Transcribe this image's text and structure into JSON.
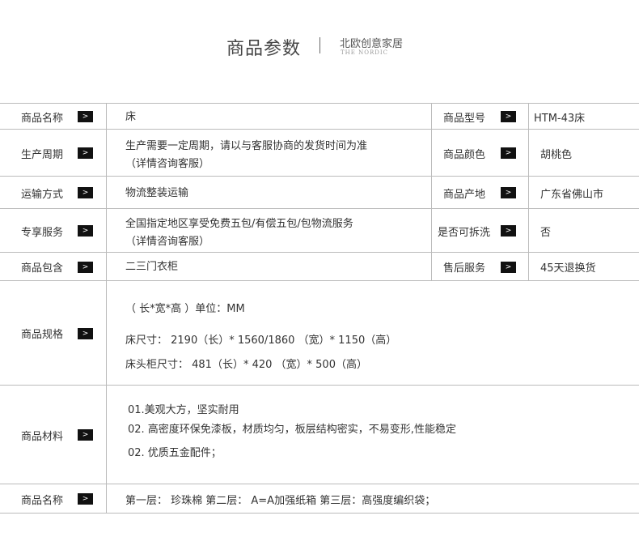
{
  "header": {
    "title": "商品参数",
    "subtitle": "北欧创意家居",
    "subtitle_en": "THE NORDIC"
  },
  "arrow_glyph": ">",
  "rows": [
    {
      "label": "商品名称",
      "value": "床",
      "label2": "商品型号",
      "value2": "HTM-43床"
    },
    {
      "label": "生产周期",
      "value_lines": [
        "生产需要一定周期，请以与客服协商的发货时间为准",
        "（详情咨询客服）"
      ],
      "label2": "商品颜色",
      "value2": "胡桃色"
    },
    {
      "label": "运输方式",
      "value": "物流整装运输",
      "label2": "商品产地",
      "value2": "广东省佛山市"
    },
    {
      "label": "专享服务",
      "value_lines": [
        "全国指定地区享受免费五包/有偿五包/包物流服务",
        "（详情咨询客服）"
      ],
      "label2": "是否可拆洗",
      "value2": "否"
    },
    {
      "label": "商品包含",
      "value": "二三门衣柜",
      "label2": "售后服务",
      "value2": "45天退换货"
    }
  ],
  "spec": {
    "label": "商品规格",
    "lines": [
      "（ 长*宽*高 ）单位：MM",
      "床尺寸：  2190（长）*  1560/1860 （宽）*   1150（高）",
      "床头柜尺寸：  481（长）*  420 （宽）*   500（高）"
    ]
  },
  "material": {
    "label": "商品材料",
    "lines": [
      "01.美观大方，坚实耐用",
      "02. 高密度环保免漆板，材质均匀，板层结构密实，不易变形,性能稳定",
      "02. 优质五金配件；"
    ]
  },
  "packaging": {
    "label": "商品名称",
    "value": "第一层：  珍珠棉    第二层：  A=A加强纸箱      第三层：高强度编织袋；"
  }
}
